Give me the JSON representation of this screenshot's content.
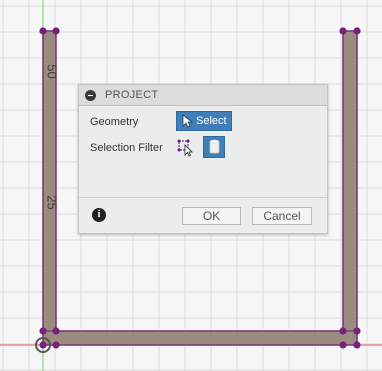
{
  "viewport": {
    "dimension_labels": [
      "50",
      "25"
    ],
    "colors": {
      "background": "#f6f6f6",
      "grid": "#dcdcdc",
      "profile_fill": "#9a8d80",
      "profile_edge": "#7a2f7a",
      "point": "#7a1f7a",
      "axis_green": "#6fd36f",
      "axis_red": "#e06060"
    }
  },
  "dialog": {
    "title": "PROJECT",
    "geometry_label": "Geometry",
    "select_label": "Select",
    "selection_filter_label": "Selection Filter",
    "info_icon_glyph": "i",
    "ok_label": "OK",
    "cancel_label": "Cancel",
    "icons": {
      "collapse": "collapse-icon",
      "select": "cursor-arrow-icon",
      "filter_1": "sketch-select-icon",
      "filter_2": "body-cylinder-icon",
      "info": "info-icon"
    }
  }
}
